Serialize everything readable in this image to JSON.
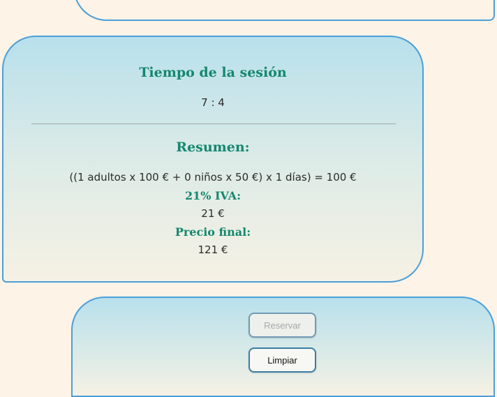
{
  "session": {
    "title": "Tiempo de la sesión",
    "time": "7 : 4"
  },
  "summary": {
    "title": "Resumen:",
    "formula": "((1 adultos x 100 € + 0 niños x 50 €) x 1 días) = 100 €",
    "vat_label": "21% IVA:",
    "vat_value": "21 €",
    "final_label": "Precio final:",
    "final_value": "121 €"
  },
  "actions": {
    "reserve_label": "Reservar",
    "clear_label": "Limpiar"
  },
  "colors": {
    "accent_green": "#14876e",
    "border_blue": "#4a9fd8",
    "page_background": "#fdf3e7"
  }
}
